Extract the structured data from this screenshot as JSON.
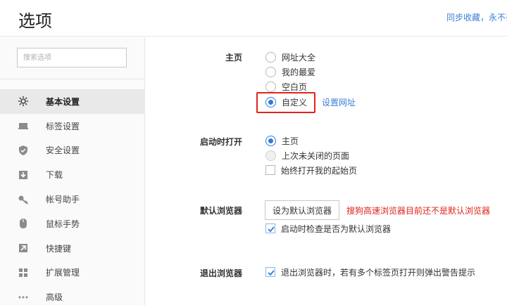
{
  "header": {
    "title": "选项",
    "sync_text": "同步收藏，永不丢"
  },
  "sidebar": {
    "search_placeholder": "搜索选项",
    "items": [
      {
        "label": "基本设置",
        "icon": "gear-icon",
        "active": true
      },
      {
        "label": "标签设置",
        "icon": "tab-icon"
      },
      {
        "label": "安全设置",
        "icon": "shield-check-icon"
      },
      {
        "label": "下载",
        "icon": "download-icon"
      },
      {
        "label": "帐号助手",
        "icon": "key-icon"
      },
      {
        "label": "鼠标手势",
        "icon": "mouse-icon"
      },
      {
        "label": "快捷键",
        "icon": "shortcut-arrow-icon"
      },
      {
        "label": "扩展管理",
        "icon": "extensions-grid-icon"
      },
      {
        "label": "高级",
        "icon": "more-dots-icon"
      }
    ]
  },
  "homepage": {
    "label": "主页",
    "options": [
      {
        "label": "网址大全",
        "checked": false
      },
      {
        "label": "我的最爱",
        "checked": false
      },
      {
        "label": "空白页",
        "checked": false
      },
      {
        "label": "自定义",
        "checked": true
      }
    ],
    "set_url_link": "设置网址"
  },
  "startup": {
    "label": "启动时打开",
    "options": [
      {
        "label": "主页",
        "checked": true
      },
      {
        "label": "上次未关闭的页面",
        "checked": false
      }
    ],
    "always_open_label": "始终打开我的起始页",
    "always_open_checked": false
  },
  "default_browser": {
    "label": "默认浏览器",
    "button_label": "设为默认浏览器",
    "warning": "搜狗高速浏览器目前还不是默认浏览器",
    "check_on_start_label": "启动时检查是否为默认浏览器",
    "check_on_start_checked": true
  },
  "exit_browser": {
    "label": "退出浏览器",
    "warn_label": "退出浏览器时，若有多个标签页打开则弹出警告提示",
    "warn_checked": true
  },
  "colors": {
    "accent": "#2f7bd9",
    "link": "#3a7fd5",
    "warning": "#e0241c"
  }
}
